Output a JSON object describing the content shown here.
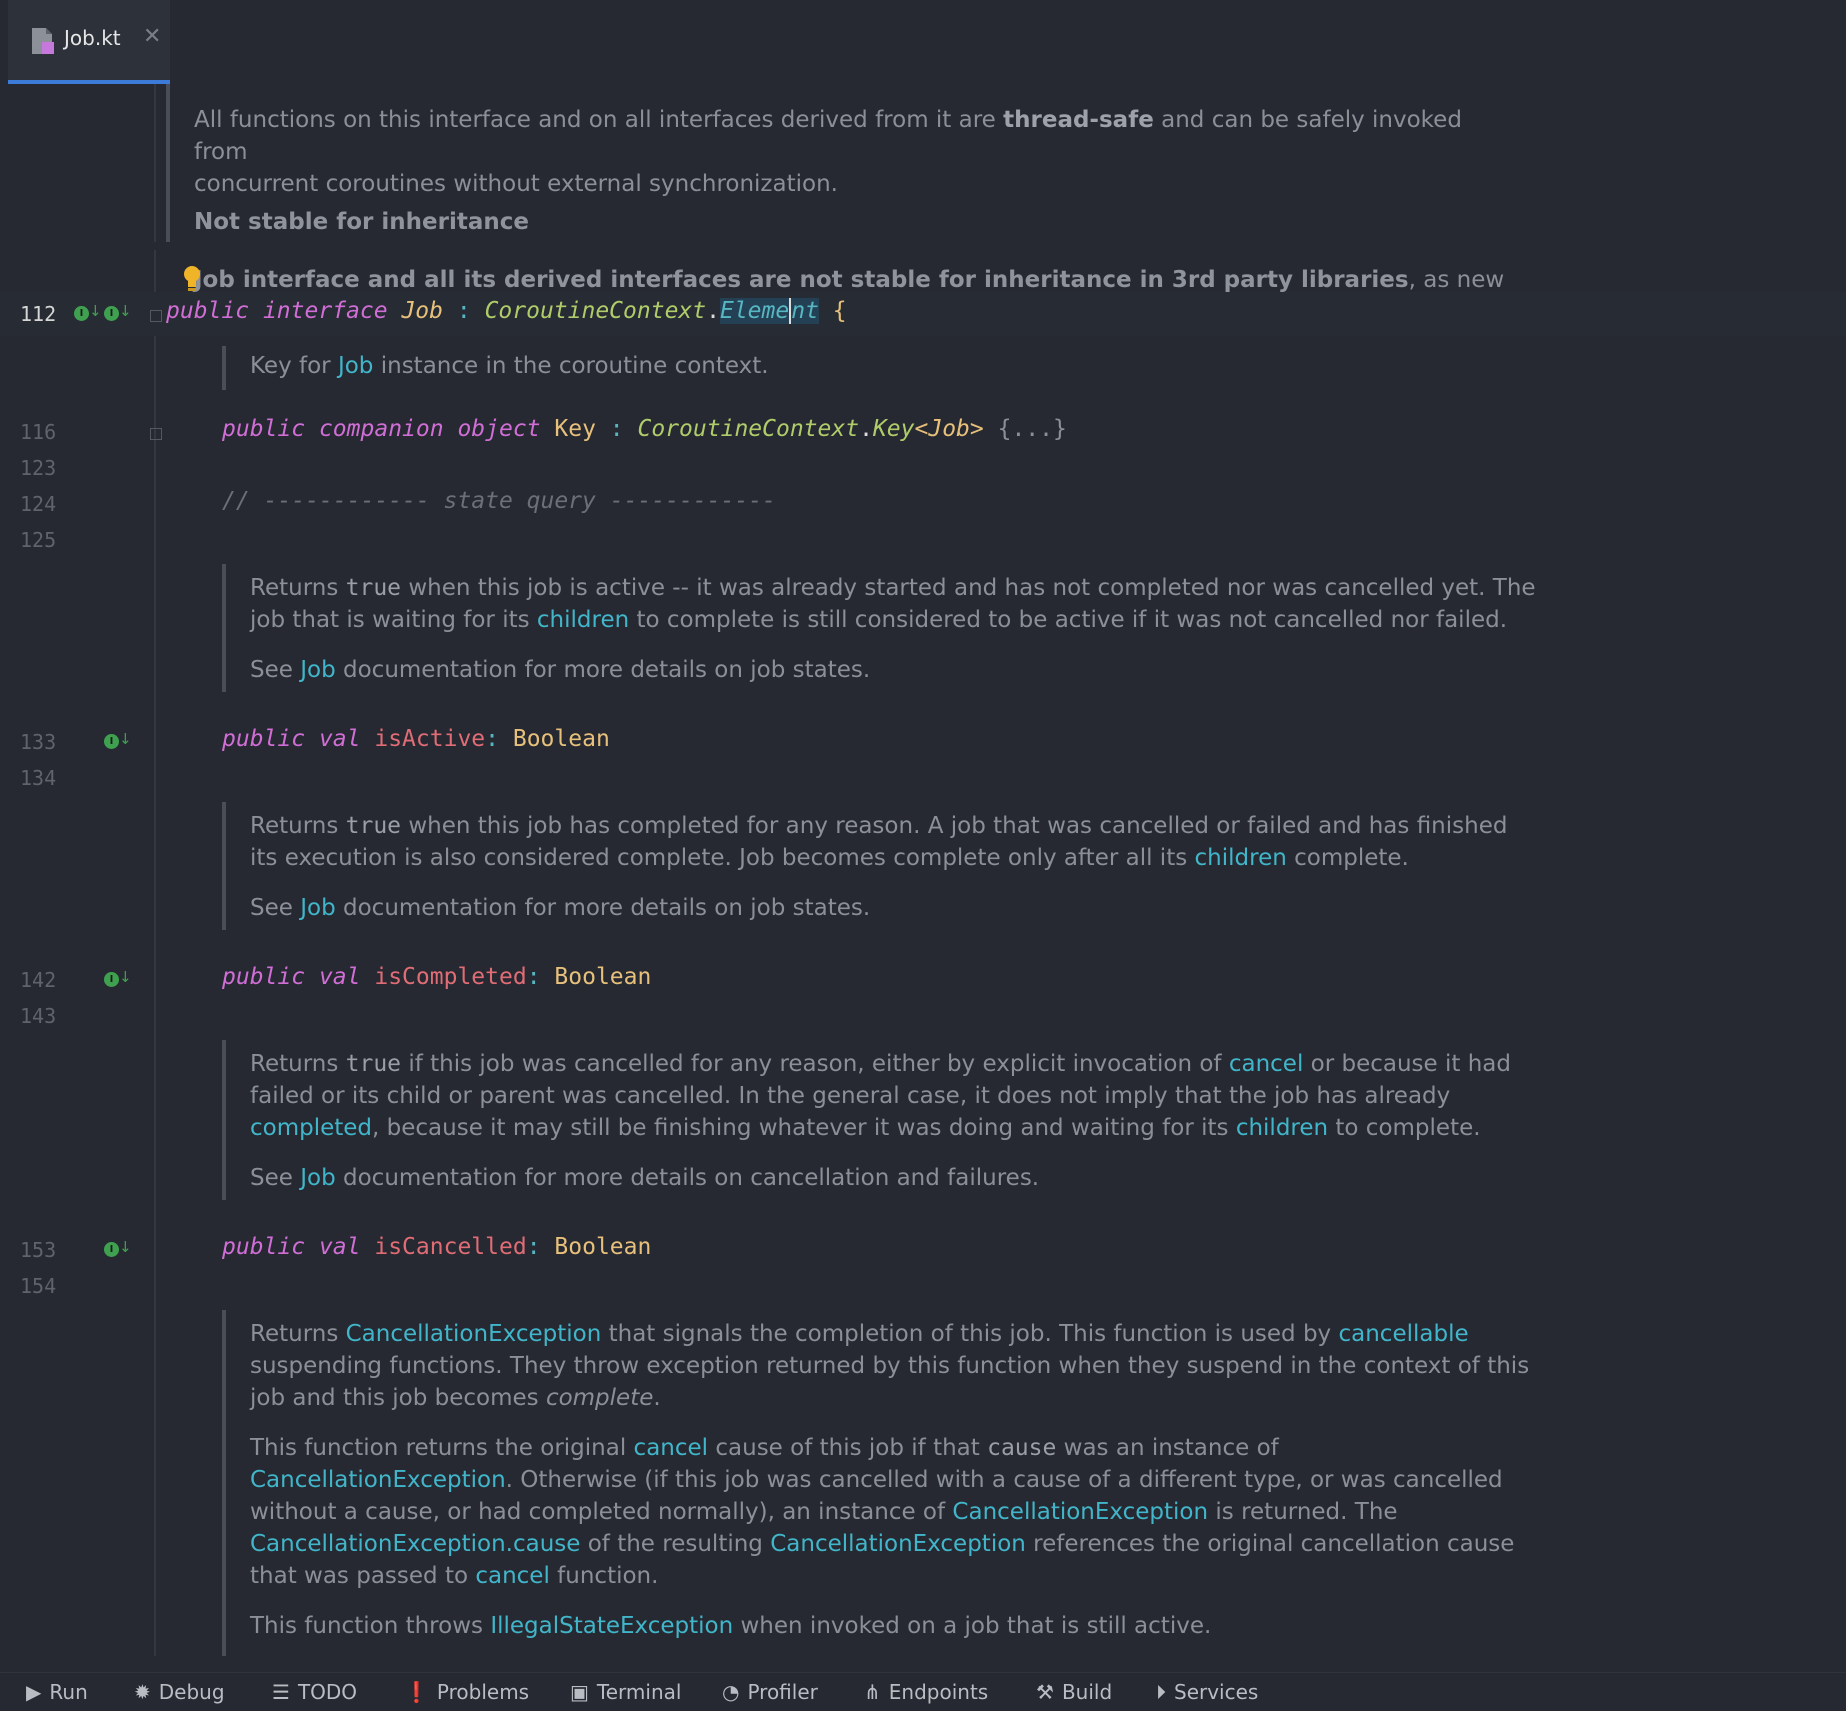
{
  "tab": {
    "file_name": "Job.kt",
    "close_glyph": "✕"
  },
  "header_doc": {
    "line1_pre": "All functions on this interface and on all interfaces derived from it are ",
    "line1_bold": "thread-safe",
    "line1_post": " and can be safely invoked from",
    "line2": "concurrent coroutines without external synchronization.",
    "heading": "Not stable for inheritance",
    "line3_bold": "Job interface and all its derived interfaces are not stable for inheritance in 3rd party libraries",
    "line3_post": ", as new"
  },
  "line_numbers": {
    "l112": "112",
    "l116": "116",
    "l123": "123",
    "l124": "124",
    "l125": "125",
    "l133": "133",
    "l134": "134",
    "l142": "142",
    "l143": "143",
    "l153": "153",
    "l154": "154"
  },
  "code": {
    "interface_line": {
      "kw_public": "public",
      "kw_interface": "interface",
      "name": "Job",
      "colon": ":",
      "ctx": "CoroutineContext",
      "dot": ".",
      "element_a": "Eleme",
      "element_b": "nt",
      "brace": "{"
    },
    "companion_line": {
      "kw_public": "public",
      "kw_companion": "companion",
      "kw_object": "object",
      "name": "Key",
      "colon": ":",
      "ctx": "CoroutineContext",
      "dot": ".",
      "key": "Key",
      "generic_open": "<",
      "generic_type": "Job",
      "generic_close": ">",
      "folded": "{...}"
    },
    "comment_line": "// ------------ state query ------------",
    "is_active": {
      "kw_public": "public",
      "kw_val": "val",
      "name": "isActive",
      "colon": ":",
      "type": "Boolean"
    },
    "is_completed": {
      "kw_public": "public",
      "kw_val": "val",
      "name": "isCompleted",
      "colon": ":",
      "type": "Boolean"
    },
    "is_cancelled": {
      "kw_public": "public",
      "kw_val": "val",
      "name": "isCancelled",
      "colon": ":",
      "type": "Boolean"
    }
  },
  "doc_key": {
    "pre": "Key for ",
    "link": "Job",
    "post": " instance in the coroutine context."
  },
  "doc_active": {
    "p1_a": "Returns ",
    "p1_code": "true",
    "p1_b": " when this job is active -- it was already started and has not completed nor was cancelled yet. The job that is waiting for its ",
    "p1_link": "children",
    "p1_c": " to complete is still considered to be active if it was not cancelled nor failed.",
    "p2_a": "See ",
    "p2_link": "Job",
    "p2_b": " documentation for more details on job states."
  },
  "doc_completed": {
    "p1_a": "Returns ",
    "p1_code": "true",
    "p1_b": " when this job has completed for any reason. A job that was cancelled or failed and has finished its execution is also considered complete. Job becomes complete only after all its ",
    "p1_link": "children",
    "p1_c": " complete.",
    "p2_a": "See ",
    "p2_link": "Job",
    "p2_b": " documentation for more details on job states."
  },
  "doc_cancelled": {
    "p1_a": "Returns ",
    "p1_code": "true",
    "p1_b": " if this job was cancelled for any reason, either by explicit invocation of ",
    "p1_link1": "cancel",
    "p1_c": " or because it had failed or its child or parent was cancelled. In the general case, it does not imply that the job has already ",
    "p1_link2": "completed",
    "p1_d": ", because it may still be finishing whatever it was doing and waiting for its ",
    "p1_link3": "children",
    "p1_e": " to complete.",
    "p2_a": "See ",
    "p2_link": "Job",
    "p2_b": " documentation for more details on cancellation and failures."
  },
  "doc_exception": {
    "p1_a": "Returns ",
    "p1_link1": "CancellationException",
    "p1_b": " that signals the completion of this job. This function is used by ",
    "p1_link2": "cancellable",
    "p1_c": " suspending functions. They throw exception returned by this function when they suspend in the context of this job and this job becomes ",
    "p1_em": "complete",
    "p1_d": ".",
    "p2_a": "This function returns the original ",
    "p2_link1": "cancel",
    "p2_b": " cause of this job if that ",
    "p2_code": "cause",
    "p2_c": " was an instance of ",
    "p2_link2": "CancellationException",
    "p2_d": ". Otherwise (if this job was cancelled with a cause of a different type, or was cancelled without a cause, or had completed normally), an instance of ",
    "p2_link3": "CancellationException",
    "p2_e": " is returned. The ",
    "p2_link4": "CancellationException.cause",
    "p2_f": " of the resulting ",
    "p2_link5": "CancellationException",
    "p2_g": " references the original cancellation cause that was passed to ",
    "p2_link6": "cancel",
    "p2_h": " function.",
    "p3_a": "This function throws ",
    "p3_link": "IllegalStateException",
    "p3_b": " when invoked on a job that is still active."
  },
  "statusbar": {
    "run": "Run",
    "debug": "Debug",
    "todo": "TODO",
    "problems": "Problems",
    "terminal": "Terminal",
    "profiler": "Profiler",
    "endpoints": "Endpoints",
    "build": "Build",
    "services": "Services"
  },
  "colors": {
    "accent": "#3d7bd9",
    "link": "#41b5c9",
    "keyword": "#d06ed6",
    "type": "#e7c07b",
    "background": "#262931"
  }
}
